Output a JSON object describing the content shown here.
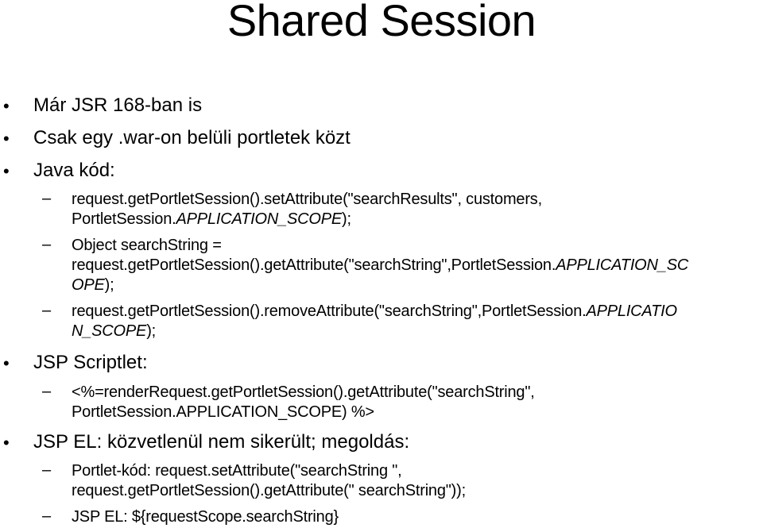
{
  "slide": {
    "title": "Shared Session",
    "items": [
      {
        "level": 1,
        "text": "Már JSR 168-ban is"
      },
      {
        "level": 1,
        "text": "Csak egy .war-on belüli portletek közt"
      },
      {
        "level": 1,
        "text": "Java kód:"
      },
      {
        "level": 2,
        "lines": [
          [
            "request.getPortletSession().setAttribute(\"searchResults\", customers,",
            ""
          ],
          [
            "PortletSession.",
            "APPLICATION_SCOPE",
            ");"
          ]
        ]
      },
      {
        "level": 2,
        "lines": [
          [
            "Object searchString ="
          ],
          [
            "request.getPortletSession().getAttribute(\"searchString\",PortletSession.",
            "APPLICATION_SC"
          ],
          [
            "",
            "OPE",
            ");"
          ]
        ]
      },
      {
        "level": 2,
        "lines": [
          [
            "request.getPortletSession().removeAttribute(\"searchString\",PortletSession.",
            "APPLICATIO"
          ],
          [
            "",
            "N_SCOPE",
            ");"
          ]
        ]
      },
      {
        "level": 1,
        "text": "JSP Scriptlet:"
      },
      {
        "level": 2,
        "lines": [
          [
            "<%=renderRequest.getPortletSession().getAttribute(\"searchString\","
          ],
          [
            "PortletSession.APPLICATION_SCOPE) %>"
          ]
        ]
      },
      {
        "level": 1,
        "text": "JSP EL: közvetlenül nem sikerült; megoldás:"
      },
      {
        "level": 2,
        "lines": [
          [
            "Portlet-kód: request.setAttribute(\"searchString \","
          ],
          [
            "request.getPortletSession().getAttribute(\" searchString\"));"
          ]
        ]
      },
      {
        "level": 2,
        "lines": [
          [
            "JSP EL: ${requestScope.searchString}"
          ]
        ]
      }
    ],
    "bullet_glyph": "•",
    "dash_glyph": "–"
  }
}
